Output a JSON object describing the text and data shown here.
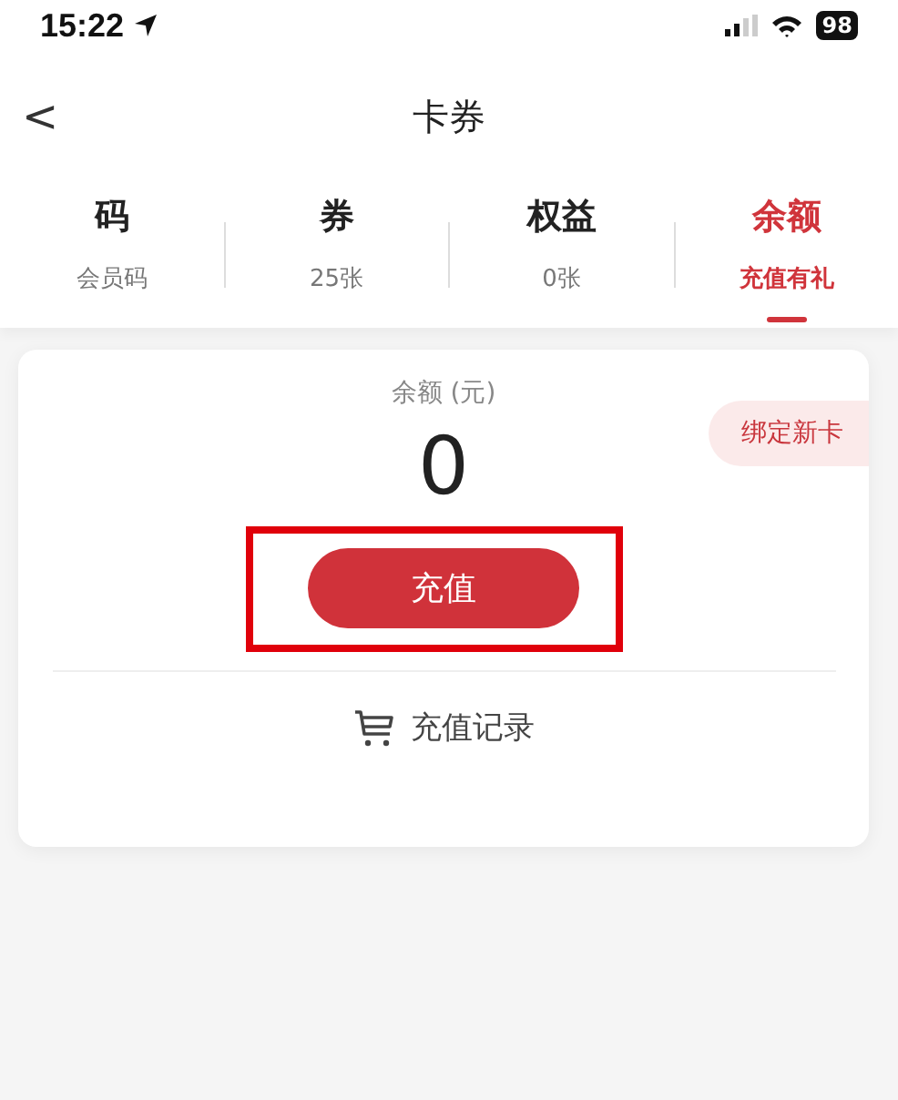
{
  "status_bar": {
    "time": "15:22",
    "battery": "98"
  },
  "header": {
    "back": "<",
    "title": "卡券"
  },
  "tabs": [
    {
      "label": "码",
      "sub": "会员码",
      "selected": false
    },
    {
      "label": "券",
      "sub": "25张",
      "selected": false
    },
    {
      "label": "权益",
      "sub": "0张",
      "selected": false
    },
    {
      "label": "余额",
      "sub": "充值有礼",
      "selected": true
    }
  ],
  "balance_card": {
    "label": "余额 (元)",
    "amount": "0",
    "bind_button": "绑定新卡",
    "recharge_button": "充值",
    "recharge_highlighted": true,
    "history_link": "充值记录"
  }
}
